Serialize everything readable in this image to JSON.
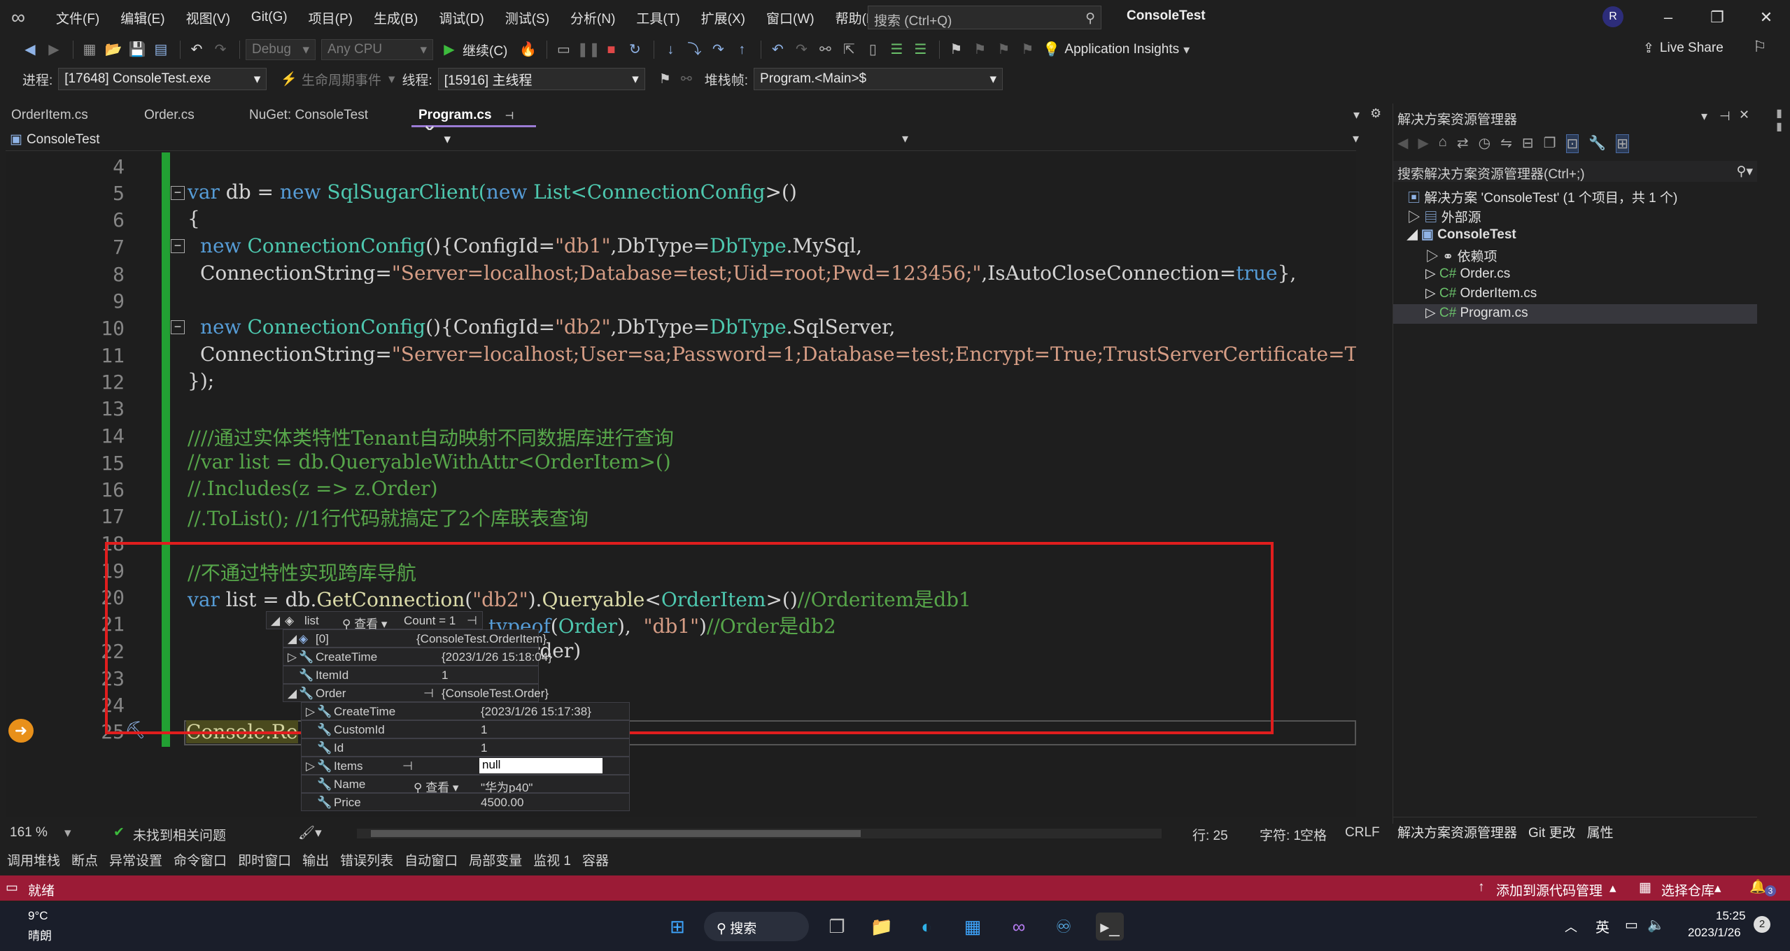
{
  "menu": [
    "文件(F)",
    "编辑(E)",
    "视图(V)",
    "Git(G)",
    "项目(P)",
    "生成(B)",
    "调试(D)",
    "测试(S)",
    "分析(N)",
    "工具(T)",
    "扩展(X)",
    "窗口(W)",
    "帮助(H)"
  ],
  "search": {
    "placeholder": "搜索 (Ctrl+Q)"
  },
  "window_title": "ConsoleTest",
  "avatar_initial": "R",
  "toolbar": {
    "config": "Debug",
    "platform": "Any CPU",
    "continue_label": "继续(C)",
    "app_insights": "Application Insights",
    "live_share": "Live Share"
  },
  "debugbar": {
    "process_label": "进程:",
    "process_value": "[17648] ConsoleTest.exe",
    "lifecycle_label": "生命周期事件",
    "thread_label": "线程:",
    "thread_value": "[15916] 主线程",
    "stackframe_label": "堆栈帧:",
    "stackframe_value": "Program.<Main>$"
  },
  "tabs": [
    "OrderItem.cs",
    "Order.cs",
    "NuGet: ConsoleTest",
    "Program.cs"
  ],
  "nav_project": "ConsoleTest",
  "line_numbers": [
    "4",
    "5",
    "6",
    "7",
    "8",
    "9",
    "10",
    "11",
    "12",
    "13",
    "14",
    "15",
    "16",
    "17",
    "18",
    "19",
    "20",
    "21",
    "22",
    "23",
    "24",
    "25"
  ],
  "code": {
    "l5a": "var",
    "l5b": " db = ",
    "l5c": "new",
    "l5d": " SqlSugarClient(",
    "l5e": "new",
    "l5f": " List<",
    "l5g": "ConnectionConfig",
    "l5h": ">()",
    "l6": "{",
    "l7a": "new",
    "l7b": " ConnectionConfig",
    "l7c": "(){ConfigId=",
    "l7d": "\"db1\"",
    "l7e": ",DbType=",
    "l7f": "DbType",
    "l7g": ".MySql,",
    "l8a": "ConnectionString=",
    "l8b": "\"Server=localhost;Database=test;Uid=root;Pwd=123456;\"",
    "l8c": ",IsAutoCloseConnection=",
    "l8d": "true",
    "l8e": "},",
    "l10a": "new",
    "l10b": " ConnectionConfig",
    "l10c": "(){ConfigId=",
    "l10d": "\"db2\"",
    "l10e": ",DbType=",
    "l10f": "DbType",
    "l10g": ".SqlServer,",
    "l11a": "ConnectionString=",
    "l11b": "\"Server=localhost;User=sa;Password=1;Database=test;Encrypt=True;TrustServerCertificate=T",
    "l12": "});",
    "l14": "////通过实体类特性Tenant自动映射不同数据库进行查询",
    "l15": "//var list = db.QueryableWithAttr<OrderItem>()",
    "l16": "//.Includes(z => z.Order)",
    "l17": "//.ToList(); //1行代码就搞定了2个库联表查询",
    "l19": "//不通过特性实现跨库导航",
    "l20a": "var",
    "l20b": " list = db.",
    "l20c": "GetConnection",
    "l20d": "(",
    "l20e": "\"db2\"",
    "l20f": ").",
    "l20g": "Queryable",
    "l20h": "<",
    "l20i": "OrderItem",
    "l20j": ">()",
    "l20k": "//Orderitem是db1",
    "l21a": "typeof",
    "l21b": "(",
    "l21c": "Order",
    "l21d": "),  ",
    "l21e": "\"db1\"",
    "l21f": ")",
    "l21g": "//Order是db2",
    "l22": "rder)",
    "l25": "Console.Re"
  },
  "datatip": {
    "root_name": "list",
    "view_label": "查看",
    "count_label": "Count = 1",
    "rows": [
      {
        "name": "[0]",
        "value": "{ConsoleTest.OrderItem}"
      },
      {
        "name": "CreateTime",
        "value": "{2023/1/26 15:18:04}"
      },
      {
        "name": "ItemId",
        "value": "1"
      },
      {
        "name": "Order",
        "value": "{ConsoleTest.Order}"
      },
      {
        "name": "CreateTime",
        "value": "{2023/1/26 15:17:38}"
      },
      {
        "name": "CustomId",
        "value": "1"
      },
      {
        "name": "Id",
        "value": "1"
      },
      {
        "name": "Items",
        "value": "null"
      },
      {
        "name": "Name",
        "value": "\"华为p40\""
      },
      {
        "name": "Price",
        "value": "4500.00"
      }
    ]
  },
  "solution_explorer": {
    "title": "解决方案资源管理器",
    "search_placeholder": "搜索解决方案资源管理器(Ctrl+;)",
    "solution": "解决方案 'ConsoleTest' (1 个项目，共 1 个)",
    "external": "外部源",
    "project": "ConsoleTest",
    "deps": "依赖项",
    "files": [
      "Order.cs",
      "OrderItem.cs",
      "Program.cs"
    ],
    "bottom_tabs": [
      "解决方案资源管理器",
      "Git 更改",
      "属性"
    ]
  },
  "statusrow": {
    "zoom": "161 %",
    "issues": "未找到相关问题",
    "line": "行: 25",
    "col": "字符: 1",
    "spaces": "空格",
    "eol": "CRLF"
  },
  "bottom_tabs": [
    "调用堆栈",
    "断点",
    "异常设置",
    "命令窗口",
    "即时窗口",
    "输出",
    "错误列表",
    "自动窗口",
    "局部变量",
    "监视 1",
    "容器"
  ],
  "statusbar": {
    "ready": "就绪",
    "add_source": "添加到源代码管理",
    "select_repo": "选择仓库",
    "notif_count": "3"
  },
  "taskbar": {
    "temp": "9°C",
    "weather": "晴朗",
    "search": "搜索",
    "ime": "英",
    "time": "15:25",
    "date": "2023/1/26",
    "badge": "2"
  },
  "colors": {
    "accent": "#9b7bd4",
    "status_bg": "#9b1b36",
    "highlight_box": "#e01e1e",
    "change_bar": "#22a033"
  }
}
